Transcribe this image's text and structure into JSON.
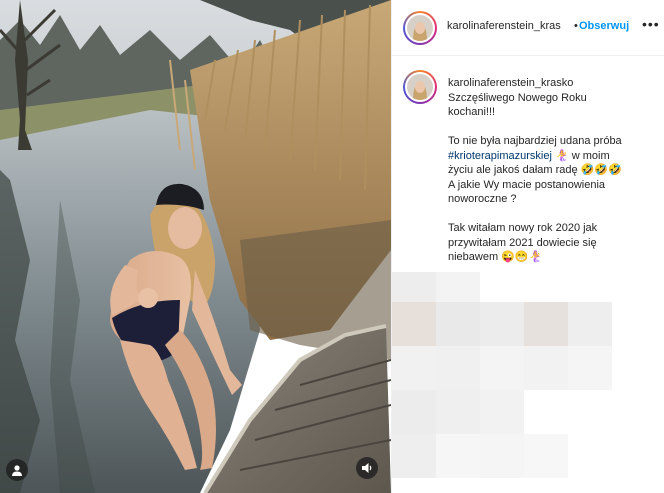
{
  "header": {
    "username": "karolinaferenstein_kras",
    "separator": "•",
    "follow_label": "Obserwuj",
    "more_label": "•••"
  },
  "caption": {
    "username": "karolinaferenstein_krasko",
    "line1": "Szczęśliwego Nowego Roku",
    "line2": "kochani!!!",
    "line3": "To nie była najbardziej udana próba",
    "hashtag": "#krioterapimazurskiej",
    "line4_emoji": "🧜‍♀️",
    "line4_rest": " w moim",
    "line5": "życiu ale jakoś dałam radę 🤣🤣🤣",
    "line6": "A jakie Wy macie postanowienia",
    "line7": "noworoczne ?",
    "line8": "Tak witałam nowy rok 2020 jak",
    "line9": "przywitałam 2021 dowiecie się",
    "line10": "niebawem 😜😁🧜‍♀️"
  },
  "icons": {
    "user_tag": "user-tag-icon",
    "sound": "volume-icon",
    "more": "more-options-icon"
  },
  "colors": {
    "link_blue": "#0095f6",
    "hashtag_blue": "#00376b",
    "text": "#262626",
    "border": "#efefef"
  }
}
